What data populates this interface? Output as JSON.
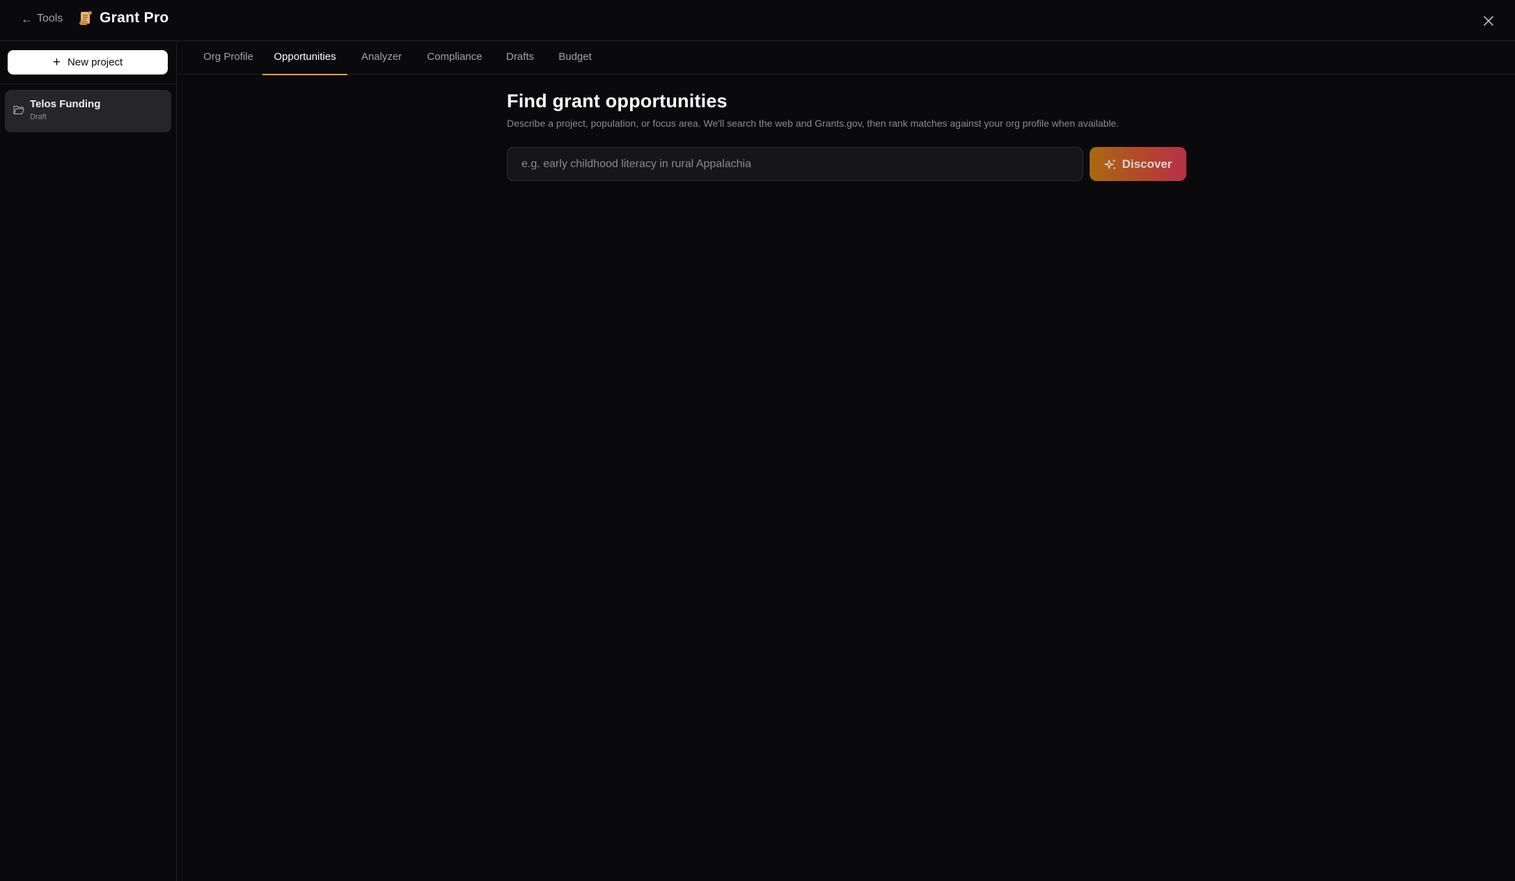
{
  "header": {
    "back_label": "Tools",
    "app_title": "Grant Pro",
    "icons": {
      "back": "arrow-left-icon",
      "logo": "scroll-icon",
      "close": "close-icon"
    }
  },
  "sidebar": {
    "new_project_label": "New project",
    "projects": [
      {
        "name": "Telos Funding",
        "status": "Draft",
        "icon": "folder-open-icon"
      }
    ]
  },
  "tabs": [
    {
      "label": "Org Profile",
      "active": false
    },
    {
      "label": "Opportunities",
      "active": true
    },
    {
      "label": "Analyzer",
      "active": false
    },
    {
      "label": "Compliance",
      "active": false
    },
    {
      "label": "Drafts",
      "active": false
    },
    {
      "label": "Budget",
      "active": false
    }
  ],
  "main": {
    "title": "Find grant opportunities",
    "subtitle": "Describe a project, population, or focus area. We'll search the web and Grants.gov, then rank matches against your org profile when available.",
    "search": {
      "value": "",
      "placeholder": "e.g. early childhood literacy in rural Appalachia"
    },
    "discover_label": "Discover",
    "discover_icon": "sparkles-icon"
  },
  "colors": {
    "background": "#0a0a0c",
    "accent": "#f59e42",
    "button_gradient_start": "#a9690f",
    "button_gradient_end": "#b73149",
    "project_item_bg": "#26262a"
  }
}
